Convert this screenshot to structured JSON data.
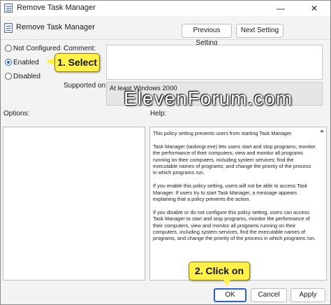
{
  "window": {
    "title": "Remove Task Manager",
    "minimize_glyph": "—",
    "close_glyph": "✕"
  },
  "header": {
    "title": "Remove Task Manager",
    "previous_setting": "Previous Setting",
    "next_setting": "Next Setting"
  },
  "state": {
    "options": [
      {
        "label": "Not Configured",
        "selected": false
      },
      {
        "label": "Enabled",
        "selected": true
      },
      {
        "label": "Disabled",
        "selected": false
      }
    ]
  },
  "comment": {
    "label": "Comment:",
    "value": ""
  },
  "supported": {
    "label": "Supported on:",
    "value": "At least Windows 2000"
  },
  "watermark": "ElevenForum.com",
  "options_label": "Options:",
  "help": {
    "label": "Help:",
    "paragraphs": [
      "This policy setting prevents users from starting Task Manager.",
      "Task Manager (taskmgr.exe) lets users start and stop programs; monitor the performance of their computers; view and monitor all programs running on their computers, including system services; find the executable names of programs; and change the priority of the process in which programs run.",
      "If you enable this policy setting, users will not be able to access Task Manager. If users try to start Task Manager, a message appears explaining that a policy prevents the action.",
      "If you disable or do not configure this policy setting, users can access Task Manager to  start and stop programs, monitor the performance of their computers, view and monitor all programs running on their computers, including system services, find the executable names of programs, and change the priority of the process in which programs run."
    ]
  },
  "buttons": {
    "ok": "OK",
    "cancel": "Cancel",
    "apply": "Apply"
  },
  "callouts": {
    "select": "1. Select",
    "click_on": "2. Click on"
  },
  "colors": {
    "callout": "#fff04a",
    "accent": "#2b63c8"
  }
}
